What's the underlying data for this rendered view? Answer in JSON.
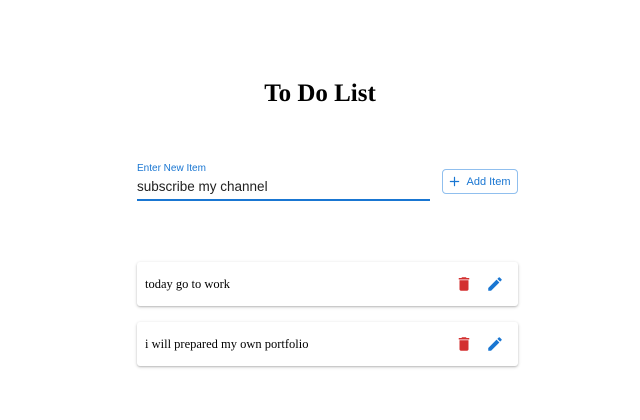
{
  "page": {
    "title": "To Do List"
  },
  "new_item": {
    "label": "Enter New Item",
    "value": "subscribe my channel"
  },
  "add_button": {
    "label": "Add Item",
    "icon": "plus-icon"
  },
  "todos": [
    {
      "text": "today go to work",
      "delete_icon": "trash-icon",
      "edit_icon": "pencil-icon"
    },
    {
      "text": "i will prepared my own portfolio",
      "delete_icon": "trash-icon",
      "edit_icon": "pencil-icon"
    }
  ],
  "colors": {
    "accent": "#1976d2",
    "delete": "#d32f2f",
    "edit": "#1976d2",
    "button_border": "#90bfee"
  }
}
